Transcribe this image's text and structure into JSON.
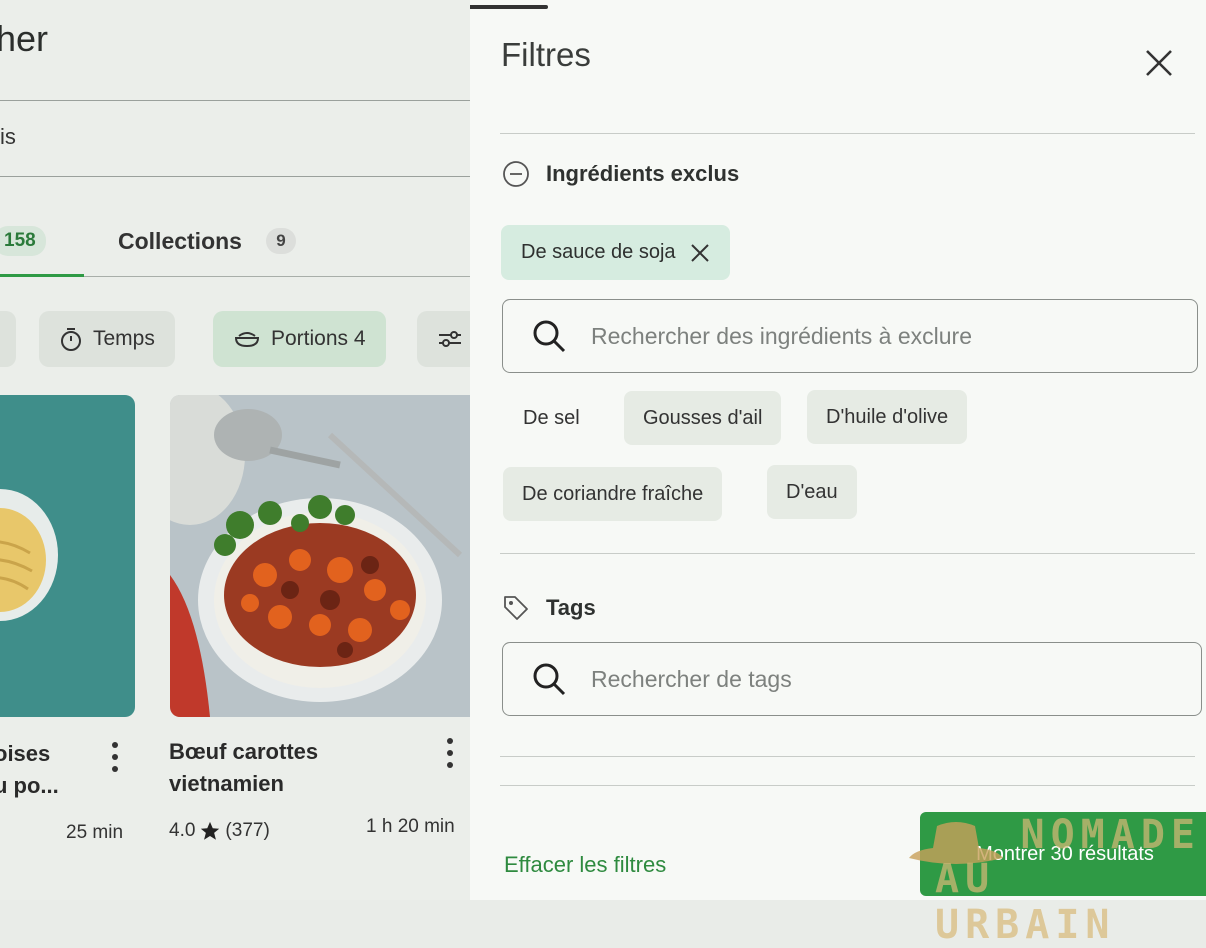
{
  "background_page": {
    "title_fragment": "her",
    "subtitle_fragment": "is",
    "tabs": [
      {
        "label": "",
        "count": "158"
      },
      {
        "label": "Collections",
        "count": "9"
      }
    ],
    "filter_chips": [
      {
        "label": "",
        "icon": "partial-chip"
      },
      {
        "label": "Temps",
        "icon": "timer-icon"
      },
      {
        "label": "Portions 4",
        "icon": "bowl-icon"
      },
      {
        "label": "",
        "icon": "sliders-icon"
      }
    ],
    "recipes": [
      {
        "title_line1": "oises",
        "title_line2": "u po...",
        "rating": "",
        "reviews": "",
        "time": "25 min"
      },
      {
        "title_line1": "Bœuf carottes",
        "title_line2": "vietnamien",
        "rating": "4.0",
        "reviews": "(377)",
        "time": "1 h 20 min"
      }
    ]
  },
  "panel": {
    "title": "Filtres",
    "excluded": {
      "heading": "Ingrédients exclus",
      "selected": [
        "De sauce de soja"
      ],
      "search_placeholder": "Rechercher des ingrédients à exclure",
      "suggestions": [
        "De sel",
        "Gousses d'ail",
        "D'huile d'olive",
        "De coriandre fraîche",
        "D'eau"
      ]
    },
    "tags": {
      "heading": "Tags",
      "search_placeholder": "Rechercher de tags"
    },
    "clear_label": "Effacer les filtres",
    "show_label": "Montrer 30 résultats"
  },
  "watermark": {
    "line1": "NOMADE",
    "line2": "AU URBAIN"
  },
  "colors": {
    "accent_green": "#2f9a45",
    "chip_selected": "#d6ece0",
    "panel_bg": "#f7f9f6"
  }
}
